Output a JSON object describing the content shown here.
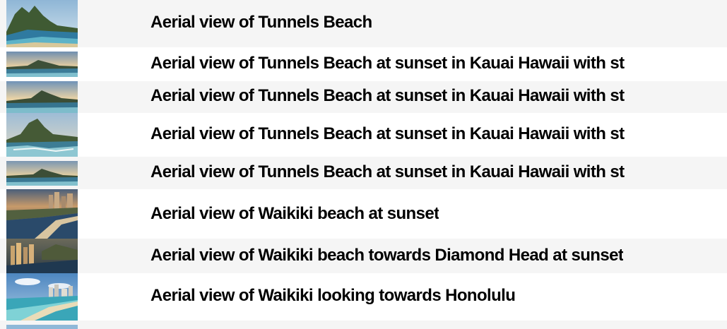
{
  "items": [
    {
      "title": "Aerial view of Tunnels Beach",
      "thumbnail": "tunnels-beach-mountains"
    },
    {
      "title": "Aerial view of Tunnels Beach at sunset in Kauai Hawaii with st",
      "thumbnail": "tunnels-beach-sunset-panorama"
    },
    {
      "title": "Aerial view of Tunnels Beach at sunset in Kauai Hawaii with st",
      "thumbnail": "tunnels-beach-sunset-panorama"
    },
    {
      "title": "Aerial view of Tunnels Beach at sunset in Kauai Hawaii with st",
      "thumbnail": "tunnels-beach-reef"
    },
    {
      "title": "Aerial view of Tunnels Beach at sunset in Kauai Hawaii with st",
      "thumbnail": "tunnels-beach-sunset-panorama"
    },
    {
      "title": "Aerial view of Waikiki beach at sunset",
      "thumbnail": "waikiki-sunset"
    },
    {
      "title": "Aerial view of Waikiki beach towards Diamond Head at sunset",
      "thumbnail": "waikiki-diamond-head-sunset"
    },
    {
      "title": "Aerial view of Waikiki looking towards Honolulu",
      "thumbnail": "waikiki-honolulu"
    }
  ]
}
